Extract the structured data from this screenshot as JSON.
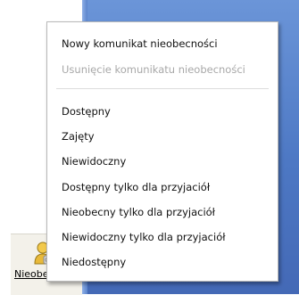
{
  "menu": {
    "items": [
      {
        "label": "Nowy komunikat nieobecności",
        "enabled": true
      },
      {
        "label": "Usunięcie komunikatu nieobecności",
        "enabled": false
      },
      {
        "label": "Dostępny",
        "enabled": true
      },
      {
        "label": "Zajęty",
        "enabled": true
      },
      {
        "label": "Niewidoczny",
        "enabled": true
      },
      {
        "label": "Dostępny tylko dla przyjaciół",
        "enabled": true
      },
      {
        "label": "Nieobecny tylko dla przyjaciół",
        "enabled": true
      },
      {
        "label": "Niewidoczny tylko dla przyjaciół",
        "enabled": true
      },
      {
        "label": "Niedostępny",
        "enabled": true
      }
    ]
  },
  "status_button": {
    "label": "Nieobecny",
    "icon": "away-person-icon"
  },
  "colors": {
    "desktop_blue": "#4d78c4",
    "menu_bg": "#ffffff",
    "disabled_text": "#a8a8a8"
  }
}
